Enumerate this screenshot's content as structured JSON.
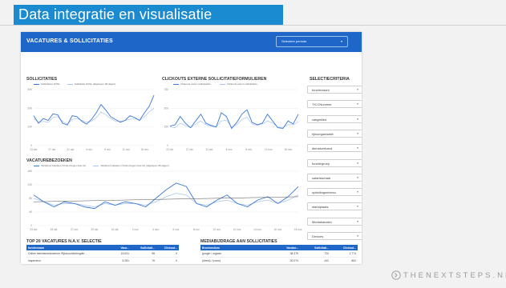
{
  "banner": {
    "title": "Data integratie en visualisatie"
  },
  "dashboard": {
    "title": "VACATURES & SOLLICITATIES",
    "period_select": "Selecteer periode"
  },
  "colors": {
    "accent": "#1e66c8",
    "banner": "#1a8bd0",
    "series_dark": "#3b78d4",
    "series_light": "#a8c4ea",
    "trend": "#555555"
  },
  "sollicitaties": {
    "title": "SOLLICITATIES",
    "legend": [
      "Sollicitaties NVNL",
      "Sollicitatie NVNL (afgelopen 28 dagen)"
    ]
  },
  "clickouts": {
    "title": "CLICKOUTS EXTERNE SOLLICITATIEFORMULIEREN",
    "legend": [
      "Clickouts extern sollicitatiefo...",
      "Clickouts extern sollicitatiefo..."
    ]
  },
  "vacaturebezoeken": {
    "title": "VACATUREBEZOEKEN",
    "legend": [
      "Vacatures bekeken (Vinfonningen doel 11)",
      "Vacatures bekeken (Vinfonningen doel 11) (afgelopen 28 dagen)"
    ]
  },
  "chart_data": [
    {
      "type": "line",
      "title": "SOLLICITATIES",
      "x": [
        "23 okt.",
        "",
        "27 okt.",
        "",
        "31 okt.",
        "",
        "4 nov.",
        "",
        "8 nov.",
        "",
        "12 nov.",
        "",
        "16 nov.",
        ""
      ],
      "y_ticks": [
        "0",
        "10K",
        "20K",
        "30K"
      ],
      "ylim": [
        0,
        30000
      ],
      "series": [
        {
          "name": "Sollicitaties NVNL",
          "values": [
            16000,
            12000,
            14500,
            13500,
            17000,
            16500,
            12000,
            11000,
            16000,
            15500,
            13000,
            11500,
            14000,
            17500,
            22000,
            19000,
            15500,
            14000,
            12500,
            13500,
            16000,
            15000,
            13500,
            17500,
            21000,
            27000
          ]
        },
        {
          "name": "Sollicitatie NVNL (afgelopen 28 dagen)",
          "values": [
            14500,
            12500,
            13000,
            12500,
            15000,
            15500,
            13000,
            11500,
            14000,
            14500,
            13500,
            12500,
            13000,
            15000,
            18000,
            16500,
            14500,
            13000,
            13000,
            13500,
            14000,
            14500,
            13500,
            15500,
            18000,
            20000
          ]
        }
      ]
    },
    {
      "type": "line",
      "title": "CLICKOUTS EXTERNE SOLLICITATIEFORMULIEREN",
      "x": [
        "23 okt.",
        "",
        "27 okt.",
        "",
        "31 okt.",
        "",
        "4 nov.",
        "",
        "8 nov.",
        "",
        "12 nov.",
        "",
        "16 nov.",
        ""
      ],
      "y_ticks": [
        "0",
        "250",
        "500",
        "750"
      ],
      "ylim": [
        0,
        750
      ],
      "series": [
        {
          "name": "Clickouts extern sollicitatiefo...",
          "values": [
            260,
            280,
            390,
            300,
            240,
            330,
            420,
            300,
            270,
            250,
            440,
            390,
            230,
            310,
            420,
            480,
            310,
            280,
            300,
            420,
            330,
            240,
            230,
            330,
            290,
            420
          ]
        },
        {
          "name": "Clickouts extern sollicitatiefo...",
          "values": [
            250,
            240,
            300,
            270,
            240,
            290,
            330,
            280,
            260,
            250,
            330,
            340,
            250,
            280,
            350,
            380,
            290,
            270,
            290,
            330,
            300,
            250,
            240,
            280,
            280,
            320
          ]
        }
      ]
    },
    {
      "type": "line",
      "title": "VACATUREBEZOEKEN",
      "x": [
        "23 okt.",
        "25 okt.",
        "27 okt.",
        "29 okt.",
        "31 okt.",
        "2 nov.",
        "4 nov.",
        "6 nov.",
        "8 nov.",
        "10 nov.",
        "12 nov.",
        "14 nov.",
        "16 nov.",
        "18 nov."
      ],
      "y_ticks": [
        "0",
        "4K",
        "8K",
        "12K",
        "16K"
      ],
      "ylim": [
        0,
        16000
      ],
      "series": [
        {
          "name": "Vacatures bekeken (Vinfonningen doel 11)",
          "values": [
            9000,
            7000,
            5500,
            7000,
            6500,
            5500,
            5000,
            7000,
            6000,
            7000,
            6500,
            5500,
            8000,
            10500,
            12500,
            11500,
            6500,
            5500,
            7500,
            9000,
            6500,
            5500,
            7500,
            8500,
            6500,
            8500,
            11500
          ]
        },
        {
          "name": "Vacatures bekeken (Vinfonningen doel 11) (afgelopen 28 dagen)",
          "values": [
            8000,
            7000,
            6000,
            6500,
            6500,
            6000,
            5500,
            6500,
            6000,
            6500,
            6500,
            6000,
            7000,
            8500,
            9500,
            9000,
            6500,
            6000,
            7000,
            7500,
            6500,
            6000,
            7000,
            7500,
            6500,
            7500,
            9000
          ]
        }
      ]
    }
  ],
  "filters": {
    "title": "SELECTIECRITERIA",
    "items": [
      "functienaam",
      "TICCNummer",
      "vakgebied",
      "rijksorganisatie",
      "dienstverband",
      "functiegroep",
      "salarisschaal",
      "opleidingsniveau",
      "standplaats",
      "Mediakanalen",
      "Devices"
    ]
  },
  "top20": {
    "title": "TOP 20 VACATURES N.A.V. SELECTIE",
    "headers": [
      "functienaam",
      "Vaca...",
      "Sollicitati...",
      "Clickout..."
    ],
    "rows": [
      [
        "Online beleidsmedewerker Rijksvoorlichtingdie...",
        "15.631",
        "98",
        "0"
      ],
      [
        "Inspecteur",
        "5.281",
        "76",
        "0"
      ],
      [
        "Juridisch Ficemsch",
        "3.915",
        "0",
        "33"
      ]
    ]
  },
  "media": {
    "title": "MEDIABIJDRAGE AAN SOLLICITATIES",
    "headers": [
      "Bron/medium",
      "Vacatur...",
      "Sollicitati...",
      "Clickout..."
    ],
    "rows": [
      [
        "google / organic",
        "38.379",
        "720",
        "1.774"
      ],
      [
        "(direct) / (none)",
        "30.074",
        "442",
        "852"
      ],
      [
        "indeed / jobboard",
        "23.095",
        "760",
        "1.047"
      ]
    ]
  },
  "footer": {
    "brand": "THENEXTSTEPS.NL"
  }
}
